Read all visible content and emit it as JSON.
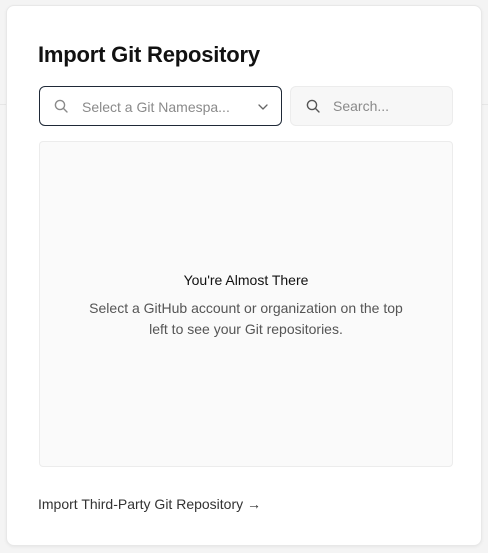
{
  "card": {
    "title": "Import Git Repository"
  },
  "namespace_select": {
    "placeholder": "Select a Git Namespa...",
    "search_icon": "search-icon",
    "chevron_icon": "chevron-down-icon"
  },
  "search": {
    "placeholder": "Search...",
    "value": "",
    "icon": "search-icon"
  },
  "empty_state": {
    "heading": "You're Almost There",
    "description": "Select a GitHub account or organization on the top left to see your Git repositories."
  },
  "footer": {
    "link_label": "Import Third-Party Git Repository →"
  },
  "colors": {
    "select_border": "#1f2937",
    "muted_text": "#8a8a8a",
    "panel_background": "#fafafa"
  }
}
